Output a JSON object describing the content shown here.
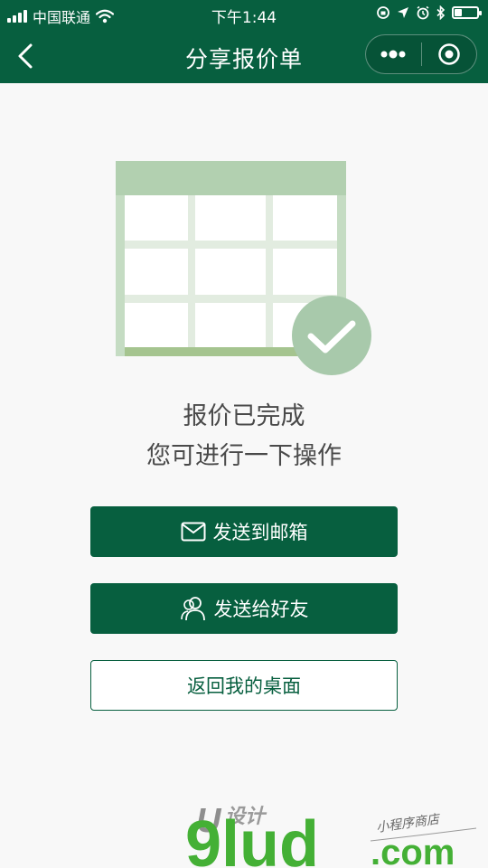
{
  "status_bar": {
    "carrier": "中国联通",
    "time": "下午1:44"
  },
  "nav": {
    "title": "分享报价单"
  },
  "message": {
    "line1": "报价已完成",
    "line2": "您可进行一下操作"
  },
  "buttons": {
    "send_email": "发送到邮箱",
    "send_friend": "发送给好友",
    "back_desktop": "返回我的桌面"
  },
  "watermark": {
    "brand": "U",
    "brand_cn": "设计",
    "domain_main": "9lud",
    "domain_tld": ".com",
    "tagline": "小程序商店"
  },
  "colors": {
    "primary": "#075f3f",
    "illustration_header": "#b2d0b0",
    "illustration_grid": "#e2ece0",
    "illustration_bottom": "#a5c48f",
    "check_circle": "#a8c9ab",
    "watermark_green": "#44b035"
  },
  "icons": [
    "wifi-icon",
    "location-icon",
    "alarm-icon",
    "bluetooth-icon",
    "battery-icon",
    "back-arrow-icon",
    "more-icon",
    "close-target-icon",
    "mail-icon",
    "users-icon",
    "checkmark-icon"
  ]
}
